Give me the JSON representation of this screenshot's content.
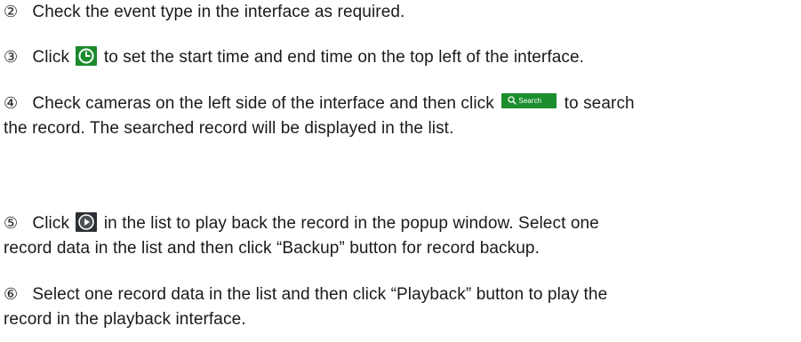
{
  "steps": [
    {
      "num": "②",
      "text": "Check the event type in the interface as required."
    },
    {
      "num": "③",
      "before": "Click",
      "after": "to set the start time and end time on the top left of the interface.",
      "icon": "clock-icon"
    },
    {
      "num": "④",
      "before": "Check cameras on the left side of the interface and then click",
      "button_label": "Search",
      "after": "to search",
      "line2": "the record. The searched record will be displayed in the list."
    },
    {
      "num": "⑤",
      "before": "Click",
      "after": "in the list to play back the record in the popup window. Select one",
      "line2": "record data in the list and then click “Backup” button for record backup.",
      "icon": "play-icon"
    },
    {
      "num": "⑥",
      "text": "Select one record data in the list and then click “Playback” button to play the",
      "line2": "record in the playback interface."
    }
  ],
  "colors": {
    "clock_icon_bg": "#1a8a2c",
    "search_button_bg": "#1b8e2e",
    "play_icon_bg": "#2b2f33"
  }
}
